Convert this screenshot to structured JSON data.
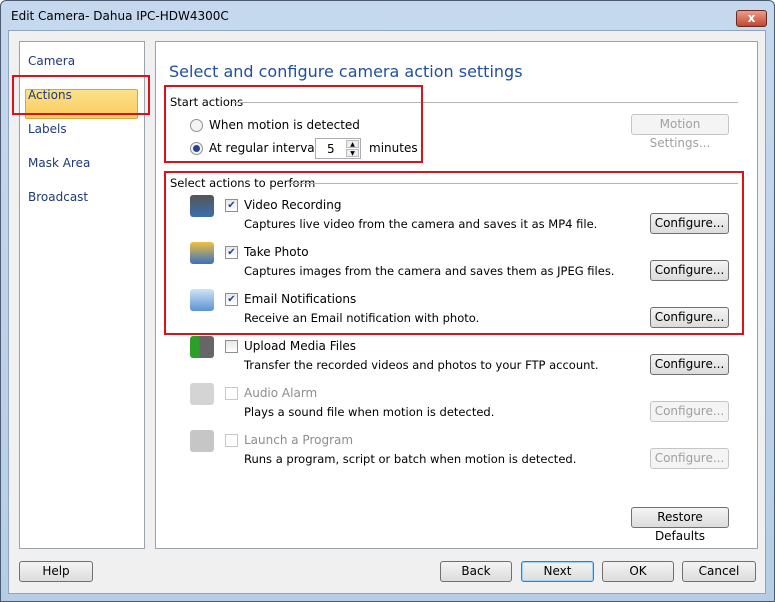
{
  "window": {
    "title": "Edit Camera- Dahua IPC-HDW4300C",
    "close": "x"
  },
  "sidebar": {
    "items": [
      {
        "label": "Camera"
      },
      {
        "label": "Actions",
        "selected": true
      },
      {
        "label": "Labels"
      },
      {
        "label": "Mask Area"
      },
      {
        "label": "Broadcast"
      }
    ]
  },
  "main": {
    "heading": "Select and configure camera action settings",
    "start_actions": {
      "title": "Start actions",
      "option_motion": "When motion is detected",
      "option_interval": "At regular intervals of",
      "interval_value": "5",
      "interval_unit": "minutes",
      "selected": "interval",
      "motion_settings": "Motion Settings..."
    },
    "select_actions_title": "Select actions to perform",
    "actions": [
      {
        "label": "Video Recording",
        "desc": "Captures live video from the camera and saves it as MP4 file.",
        "checked": true,
        "enabled": true,
        "icon": "video-record-icon",
        "configure": "Configure..."
      },
      {
        "label": "Take Photo",
        "desc": "Captures images from the camera and saves them as JPEG files.",
        "checked": true,
        "enabled": true,
        "icon": "webcam-photo-icon",
        "configure": "Configure..."
      },
      {
        "label": "Email Notifications",
        "desc": "Receive an Email notification with photo.",
        "checked": true,
        "enabled": true,
        "icon": "email-icon",
        "configure": "Configure..."
      },
      {
        "label": "Upload Media Files",
        "desc": "Transfer the recorded videos and photos to your FTP account.",
        "checked": false,
        "enabled": true,
        "icon": "upload-icon",
        "configure": "Configure..."
      },
      {
        "label": "Audio Alarm",
        "desc": "Plays a sound file when motion is detected.",
        "checked": false,
        "enabled": false,
        "icon": "bell-icon",
        "configure": "Configure..."
      },
      {
        "label": "Launch a Program",
        "desc": "Runs a program, script or batch when motion is detected.",
        "checked": false,
        "enabled": false,
        "icon": "program-icon",
        "configure": "Configure..."
      }
    ],
    "restore_defaults": "Restore Defaults"
  },
  "footer": {
    "help": "Help",
    "back": "Back",
    "next": "Next",
    "ok": "OK",
    "cancel": "Cancel"
  },
  "colors": {
    "highlight": "#e0101a",
    "heading": "#1f4fa0",
    "selected_nav": "#f8cc5e"
  }
}
